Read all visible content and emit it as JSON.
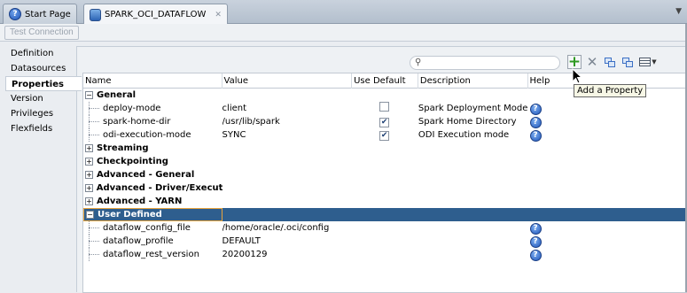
{
  "tabs": [
    {
      "label": "Start Page",
      "icon": "help-icon",
      "active": false
    },
    {
      "label": "SPARK_OCI_DATAFLOW",
      "icon": "database-icon",
      "active": true
    }
  ],
  "toolbar": {
    "test_connection_label": "Test Connection"
  },
  "nav": {
    "items": [
      "Definition",
      "Datasources",
      "Properties",
      "Version",
      "Privileges",
      "Flexfields"
    ],
    "selected": "Properties"
  },
  "table_toolbar": {
    "search_placeholder": "",
    "tooltip": "Add a Property",
    "icons": [
      "add-icon",
      "delete-icon",
      "copy-icon",
      "paste-icon",
      "columns-icon"
    ]
  },
  "table": {
    "columns": [
      "Name",
      "Value",
      "Use Default",
      "Description",
      "Help"
    ],
    "rows": [
      {
        "type": "group",
        "name": "General",
        "expanded": true
      },
      {
        "type": "prop",
        "name": "deploy-mode",
        "value": "client",
        "use_default": false,
        "description": "Spark Deployment Mode",
        "help": true
      },
      {
        "type": "prop",
        "name": "spark-home-dir",
        "value": "/usr/lib/spark",
        "use_default": true,
        "description": "Spark Home Directory",
        "help": true
      },
      {
        "type": "prop",
        "name": "odi-execution-mode",
        "value": "SYNC",
        "use_default": true,
        "description": "ODI Execution mode",
        "help": true
      },
      {
        "type": "group",
        "name": "Streaming",
        "expanded": false
      },
      {
        "type": "group",
        "name": "Checkpointing",
        "expanded": false
      },
      {
        "type": "group",
        "name": "Advanced - General",
        "expanded": false
      },
      {
        "type": "group",
        "name": "Advanced - Driver/Executo",
        "expanded": false
      },
      {
        "type": "group",
        "name": "Advanced - YARN",
        "expanded": false
      },
      {
        "type": "group",
        "name": "User Defined",
        "expanded": true,
        "selected": true
      },
      {
        "type": "prop",
        "name": "dataflow_config_file",
        "value": "/home/oracle/.oci/config",
        "description": "",
        "help": true
      },
      {
        "type": "prop",
        "name": "dataflow_profile",
        "value": "DEFAULT",
        "description": "",
        "help": true
      },
      {
        "type": "prop",
        "name": "dataflow_rest_version",
        "value": "20200129",
        "description": "",
        "help": true
      }
    ]
  },
  "colors": {
    "selection": "#2e5e8e",
    "selection_outline": "#e8a33c",
    "add_icon": "#2f9a22"
  }
}
